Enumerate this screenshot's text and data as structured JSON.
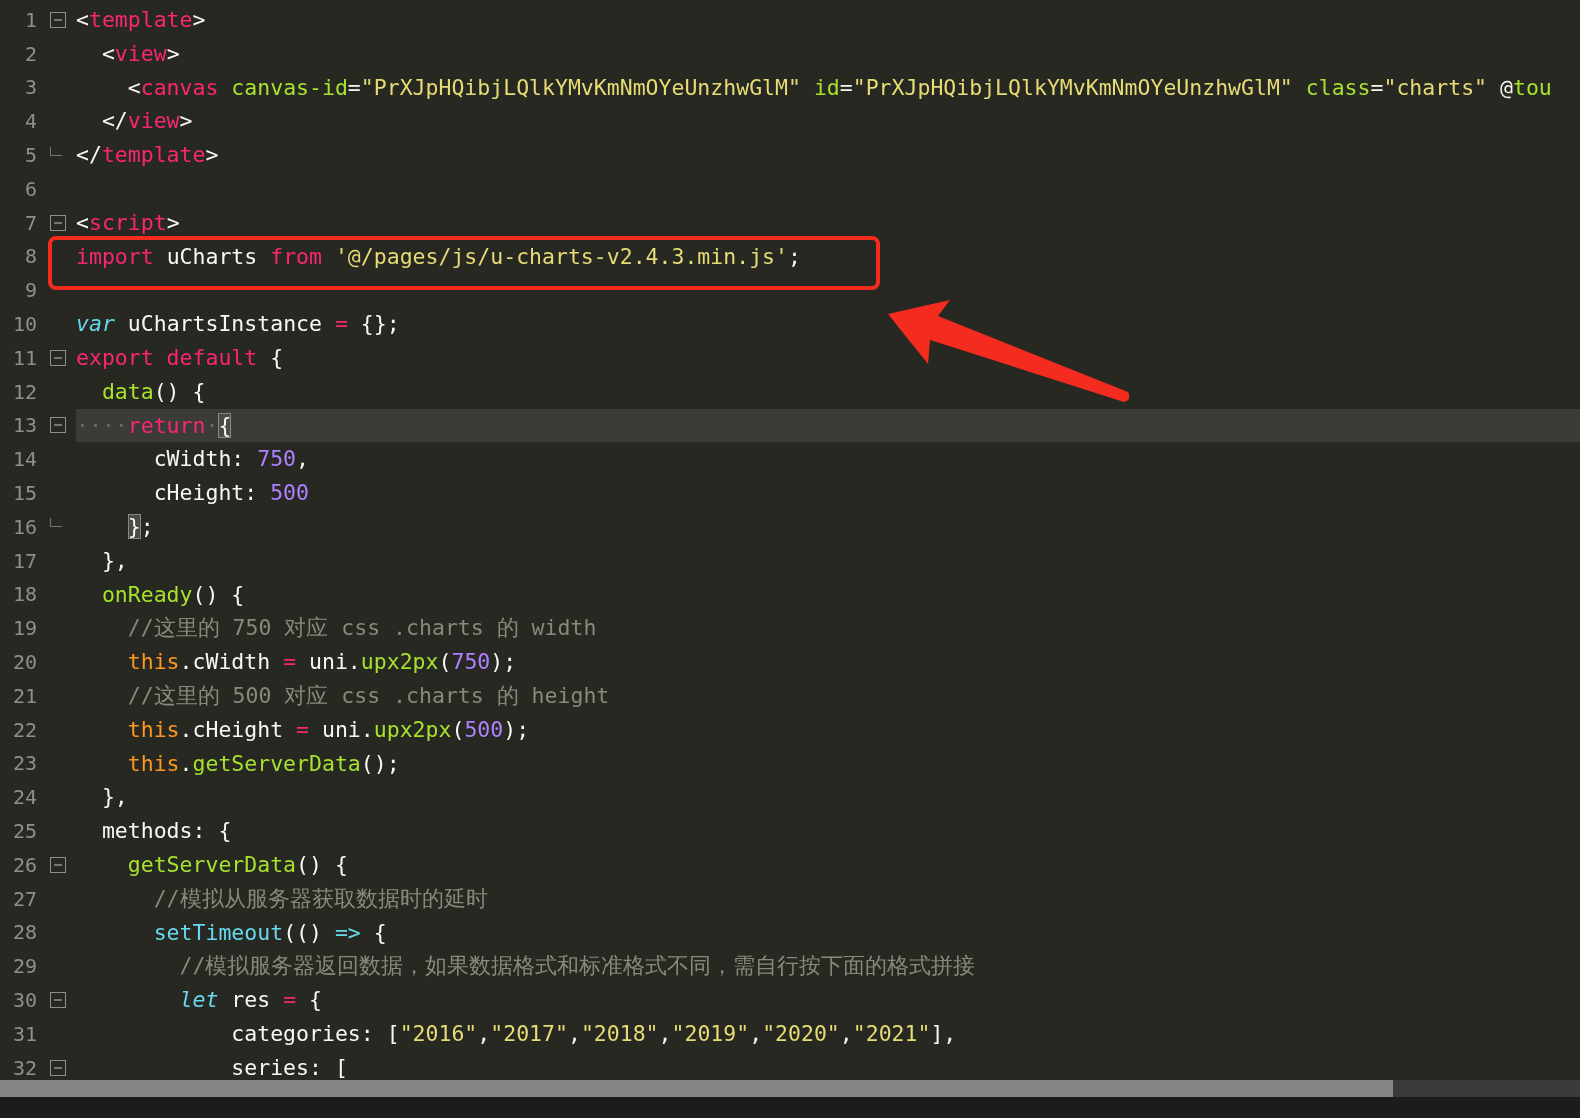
{
  "lines": [
    {
      "number": "1",
      "foldable": true,
      "fold_end": false,
      "tokens": [
        {
          "kind": "punct",
          "text": "<"
        },
        {
          "kind": "tag",
          "text": "template"
        },
        {
          "kind": "punct",
          "text": ">"
        }
      ]
    },
    {
      "number": "2",
      "foldable": false,
      "fold_end": false,
      "tokens": [
        {
          "kind": "punct",
          "text": "  <"
        },
        {
          "kind": "tag",
          "text": "view"
        },
        {
          "kind": "punct",
          "text": ">"
        }
      ]
    },
    {
      "number": "3",
      "foldable": false,
      "fold_end": false,
      "tokens": [
        {
          "kind": "punct",
          "text": "    <"
        },
        {
          "kind": "tag",
          "text": "canvas"
        },
        {
          "kind": "attr",
          "text": " canvas-id"
        },
        {
          "kind": "punct",
          "text": "="
        },
        {
          "kind": "string",
          "text": "\"PrXJpHQibjLQlkYMvKmNmOYeUnzhwGlM\""
        },
        {
          "kind": "attr",
          "text": " id"
        },
        {
          "kind": "punct",
          "text": "="
        },
        {
          "kind": "string",
          "text": "\"PrXJpHQibjLQlkYMvKmNmOYeUnzhwGlM\""
        },
        {
          "kind": "attr",
          "text": " class"
        },
        {
          "kind": "punct",
          "text": "="
        },
        {
          "kind": "string",
          "text": "\"charts\""
        },
        {
          "kind": "punct",
          "text": " @"
        },
        {
          "kind": "attr",
          "text": "tou"
        }
      ]
    },
    {
      "number": "4",
      "foldable": false,
      "fold_end": false,
      "tokens": [
        {
          "kind": "punct",
          "text": "  </"
        },
        {
          "kind": "tag",
          "text": "view"
        },
        {
          "kind": "punct",
          "text": ">"
        }
      ]
    },
    {
      "number": "5",
      "foldable": false,
      "fold_end": true,
      "tokens": [
        {
          "kind": "punct",
          "text": "</"
        },
        {
          "kind": "tag",
          "text": "template"
        },
        {
          "kind": "punct",
          "text": ">"
        }
      ]
    },
    {
      "number": "6",
      "foldable": false,
      "fold_end": false
    },
    {
      "number": "7",
      "foldable": true,
      "fold_end": false,
      "tokens": [
        {
          "kind": "punct",
          "text": "<"
        },
        {
          "kind": "tag",
          "text": "script"
        },
        {
          "kind": "punct",
          "text": ">"
        }
      ]
    },
    {
      "number": "8",
      "foldable": false,
      "fold_end": false,
      "boxed": true,
      "tokens": [
        {
          "kind": "keyword",
          "text": "import"
        },
        {
          "kind": "punct",
          "text": " uCharts "
        },
        {
          "kind": "keyword",
          "text": "from"
        },
        {
          "kind": "string",
          "text": " '@/pages/js/u-charts-v2.4.3.min.js'"
        },
        {
          "kind": "punct",
          "text": ";"
        }
      ]
    },
    {
      "number": "9",
      "foldable": false,
      "fold_end": false
    },
    {
      "number": "10",
      "foldable": false,
      "fold_end": false,
      "tokens": [
        {
          "kind": "storage",
          "text": "var"
        },
        {
          "kind": "punct",
          "text": " uChartsInstance "
        },
        {
          "kind": "keyword",
          "text": "="
        },
        {
          "kind": "punct",
          "text": " {};"
        }
      ]
    },
    {
      "number": "11",
      "foldable": true,
      "fold_end": false,
      "tokens": [
        {
          "kind": "keyword",
          "text": "export default"
        },
        {
          "kind": "punct",
          "text": " {"
        }
      ]
    },
    {
      "number": "12",
      "foldable": false,
      "fold_end": false,
      "tokens": [
        {
          "kind": "func",
          "text": "  data"
        },
        {
          "kind": "punct",
          "text": "() {"
        }
      ]
    },
    {
      "number": "13",
      "foldable": true,
      "fold_end": false,
      "current": true,
      "tokens": [
        {
          "kind": "whitespace",
          "text": "····"
        },
        {
          "kind": "keyword",
          "text": "return"
        },
        {
          "kind": "whitespace",
          "text": "·"
        },
        {
          "kind": "match",
          "text": "{"
        }
      ]
    },
    {
      "number": "14",
      "foldable": false,
      "fold_end": false,
      "tokens": [
        {
          "kind": "punct",
          "text": "      cWidth: "
        },
        {
          "kind": "number",
          "text": "750"
        },
        {
          "kind": "punct",
          "text": ","
        }
      ]
    },
    {
      "number": "15",
      "foldable": false,
      "fold_end": false,
      "tokens": [
        {
          "kind": "punct",
          "text": "      cHeight: "
        },
        {
          "kind": "number",
          "text": "500"
        }
      ]
    },
    {
      "number": "16",
      "foldable": false,
      "fold_end": true,
      "tokens": [
        {
          "kind": "match",
          "text": "    }"
        },
        {
          "kind": "punct",
          "text": ";"
        }
      ]
    },
    {
      "number": "17",
      "foldable": false,
      "fold_end": false,
      "tokens": [
        {
          "kind": "punct",
          "text": "  },"
        }
      ]
    },
    {
      "number": "18",
      "foldable": false,
      "fold_end": false,
      "tokens": [
        {
          "kind": "func",
          "text": "  onReady"
        },
        {
          "kind": "punct",
          "text": "() {"
        }
      ]
    },
    {
      "number": "19",
      "foldable": false,
      "fold_end": false,
      "tokens": [
        {
          "kind": "comment",
          "text": "    //这里的 750 对应 css .charts 的 width"
        }
      ]
    },
    {
      "number": "20",
      "foldable": false,
      "fold_end": false,
      "tokens": [
        {
          "kind": "this",
          "text": "    this"
        },
        {
          "kind": "punct",
          "text": ".cWidth "
        },
        {
          "kind": "keyword",
          "text": "="
        },
        {
          "kind": "punct",
          "text": " uni."
        },
        {
          "kind": "func",
          "text": "upx2px"
        },
        {
          "kind": "punct",
          "text": "("
        },
        {
          "kind": "number",
          "text": "750"
        },
        {
          "kind": "punct",
          "text": ");"
        }
      ]
    },
    {
      "number": "21",
      "foldable": false,
      "fold_end": false,
      "tokens": [
        {
          "kind": "comment",
          "text": "    //这里的 500 对应 css .charts 的 height"
        }
      ]
    },
    {
      "number": "22",
      "foldable": false,
      "fold_end": false,
      "tokens": [
        {
          "kind": "this",
          "text": "    this"
        },
        {
          "kind": "punct",
          "text": ".cHeight "
        },
        {
          "kind": "keyword",
          "text": "="
        },
        {
          "kind": "punct",
          "text": " uni."
        },
        {
          "kind": "func",
          "text": "upx2px"
        },
        {
          "kind": "punct",
          "text": "("
        },
        {
          "kind": "number",
          "text": "500"
        },
        {
          "kind": "punct",
          "text": ");"
        }
      ]
    },
    {
      "number": "23",
      "foldable": false,
      "fold_end": false,
      "tokens": [
        {
          "kind": "this",
          "text": "    this"
        },
        {
          "kind": "punct",
          "text": "."
        },
        {
          "kind": "func",
          "text": "getServerData"
        },
        {
          "kind": "punct",
          "text": "();"
        }
      ]
    },
    {
      "number": "24",
      "foldable": false,
      "fold_end": false,
      "tokens": [
        {
          "kind": "punct",
          "text": "  },"
        }
      ]
    },
    {
      "number": "25",
      "foldable": false,
      "fold_end": false,
      "tokens": [
        {
          "kind": "punct",
          "text": "  methods: {"
        }
      ]
    },
    {
      "number": "26",
      "foldable": true,
      "fold_end": false,
      "tokens": [
        {
          "kind": "func",
          "text": "    getServerData"
        },
        {
          "kind": "punct",
          "text": "() {"
        }
      ]
    },
    {
      "number": "27",
      "foldable": false,
      "fold_end": false,
      "tokens": [
        {
          "kind": "comment",
          "text": "      //模拟从服务器获取数据时的延时"
        }
      ]
    },
    {
      "number": "28",
      "foldable": false,
      "fold_end": false,
      "tokens": [
        {
          "kind": "support",
          "text": "      setTimeout"
        },
        {
          "kind": "punct",
          "text": "(() "
        },
        {
          "kind": "support",
          "text": "=>"
        },
        {
          "kind": "punct",
          "text": " {"
        }
      ]
    },
    {
      "number": "29",
      "foldable": false,
      "fold_end": false,
      "tokens": [
        {
          "kind": "comment",
          "text": "        //模拟服务器返回数据，如果数据格式和标准格式不同，需自行按下面的格式拼接"
        }
      ]
    },
    {
      "number": "30",
      "foldable": true,
      "fold_end": false,
      "tokens": [
        {
          "kind": "storage",
          "text": "        let"
        },
        {
          "kind": "punct",
          "text": " res "
        },
        {
          "kind": "keyword",
          "text": "="
        },
        {
          "kind": "punct",
          "text": " {"
        }
      ]
    },
    {
      "number": "31",
      "foldable": false,
      "fold_end": false,
      "tokens": [
        {
          "kind": "punct",
          "text": "            categories: ["
        },
        {
          "kind": "string",
          "text": "\"2016\""
        },
        {
          "kind": "punct",
          "text": ","
        },
        {
          "kind": "string",
          "text": "\"2017\""
        },
        {
          "kind": "punct",
          "text": ","
        },
        {
          "kind": "string",
          "text": "\"2018\""
        },
        {
          "kind": "punct",
          "text": ","
        },
        {
          "kind": "string",
          "text": "\"2019\""
        },
        {
          "kind": "punct",
          "text": ","
        },
        {
          "kind": "string",
          "text": "\"2020\""
        },
        {
          "kind": "punct",
          "text": ","
        },
        {
          "kind": "string",
          "text": "\"2021\""
        },
        {
          "kind": "punct",
          "text": "],"
        }
      ]
    },
    {
      "number": "32",
      "foldable": true,
      "fold_end": false,
      "tokens": [
        {
          "kind": "punct",
          "text": "            series: ["
        }
      ]
    }
  ]
}
